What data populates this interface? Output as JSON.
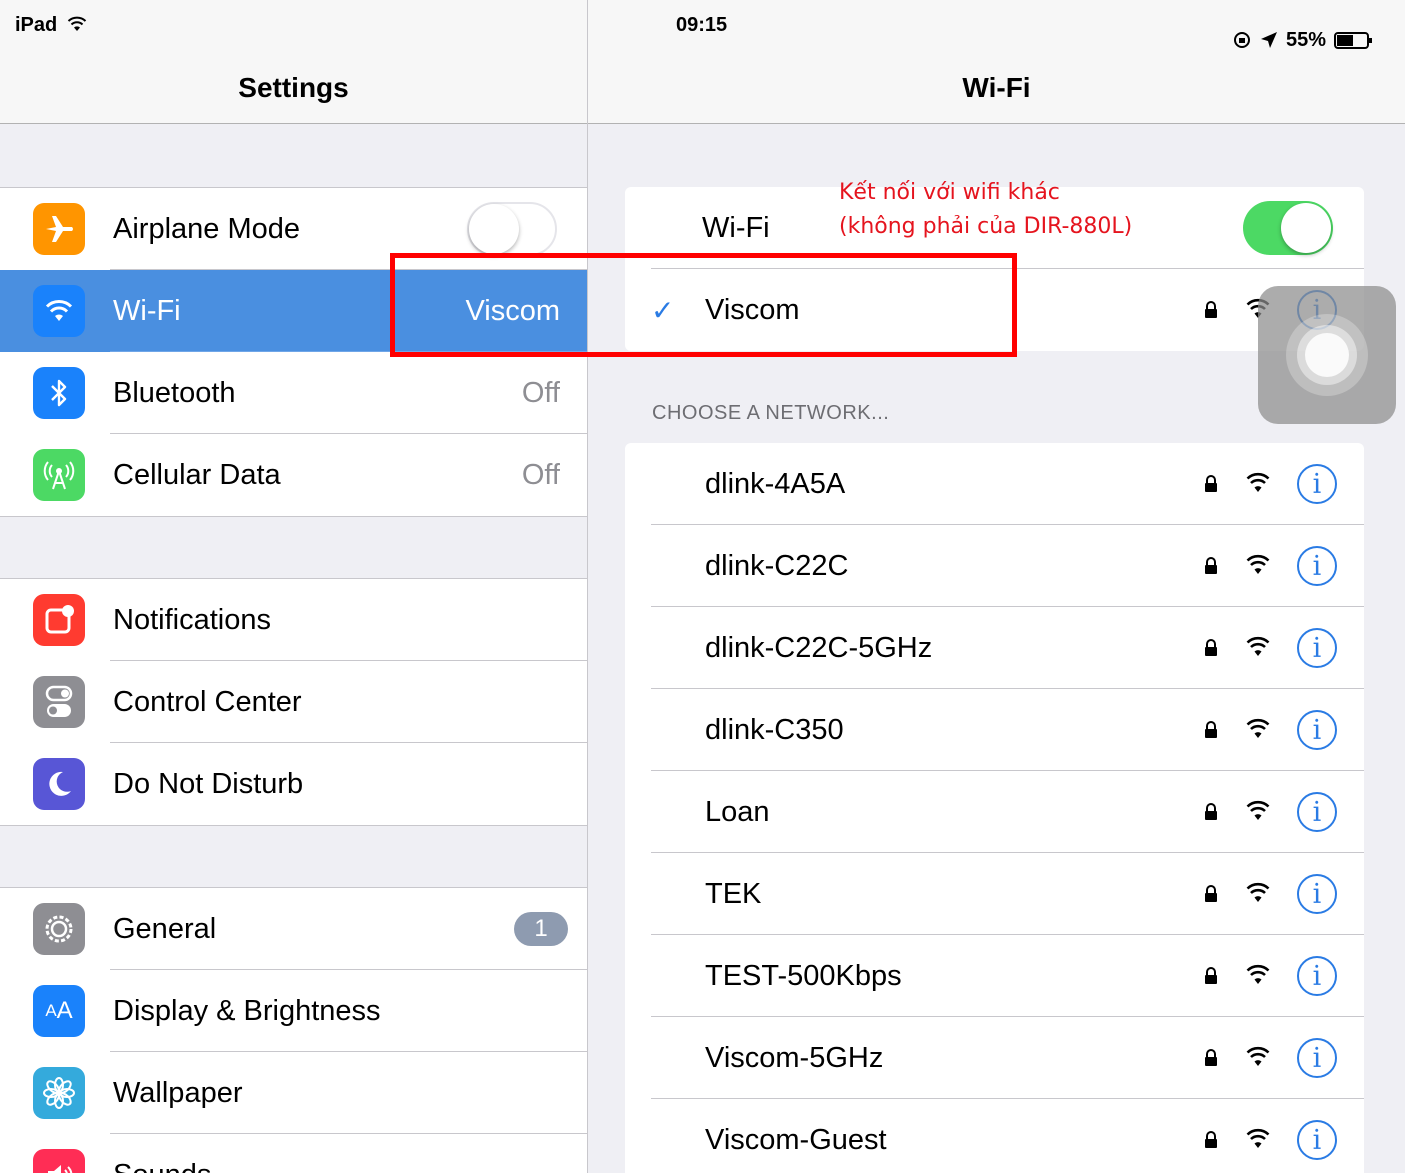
{
  "status": {
    "device": "iPad",
    "time": "09:15",
    "battery": "55%",
    "battery_level": 0.55
  },
  "master": {
    "title": "Settings",
    "groups": [
      {
        "items": [
          {
            "label": "Airplane Mode",
            "icon": "airplane-icon",
            "color": "#ff9500",
            "toggle": "off"
          },
          {
            "label": "Wi-Fi",
            "icon": "wifi-icon",
            "color": "#1a82fb",
            "value": "Viscom",
            "selected": true
          },
          {
            "label": "Bluetooth",
            "icon": "bluetooth-icon",
            "color": "#1a82fb",
            "value": "Off"
          },
          {
            "label": "Cellular Data",
            "icon": "cellular-antenna-icon",
            "color": "#4cd964",
            "value": "Off"
          }
        ]
      },
      {
        "items": [
          {
            "label": "Notifications",
            "icon": "notifications-icon",
            "color": "#ff3b30"
          },
          {
            "label": "Control Center",
            "icon": "toggles-icon",
            "color": "#8e8e93"
          },
          {
            "label": "Do Not Disturb",
            "icon": "moon-icon",
            "color": "#5856d6"
          }
        ]
      },
      {
        "items": [
          {
            "label": "General",
            "icon": "gear-icon",
            "color": "#8e8e93",
            "badge": "1"
          },
          {
            "label": "Display & Brightness",
            "icon": "text-size-icon",
            "color": "#1a82fb"
          },
          {
            "label": "Wallpaper",
            "icon": "flower-icon",
            "color": "#34aadc"
          },
          {
            "label": "Sounds",
            "icon": "speaker-icon",
            "color": "#ff2d55"
          }
        ]
      }
    ]
  },
  "detail": {
    "title": "Wi-Fi",
    "wifi_label": "Wi-Fi",
    "wifi_toggle": "on",
    "connected_network": "Viscom",
    "section_header": "CHOOSE A NETWORK...",
    "networks": [
      "dlink-4A5A",
      "dlink-C22C",
      "dlink-C22C-5GHz",
      "dlink-C350",
      "Loan",
      "TEK",
      "TEST-500Kbps",
      "Viscom-5GHz",
      "Viscom-Guest"
    ],
    "info_glyph": "i"
  },
  "annotation": {
    "line1": "Kết nối với wifi khác",
    "line2": "(không phải của DIR-880L)",
    "color": "#ff0000"
  }
}
